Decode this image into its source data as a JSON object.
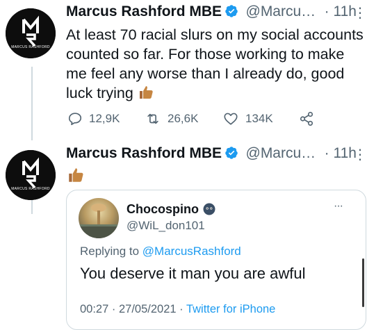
{
  "tweet1": {
    "author_name": "Marcus Rashford MBE",
    "author_handle": "@Marcu…",
    "time": "· 11h",
    "text": "At least 70 racial slurs on my social accounts counted so far. For those working to make me feel any worse than I already do, good luck trying",
    "replies": "12,9K",
    "retweets": "26,6K",
    "likes": "134K",
    "avatar_caption": "MARCUS RASHFORD"
  },
  "tweet2": {
    "author_name": "Marcus Rashford MBE",
    "author_handle": "@Marcu…",
    "time": "· 11h",
    "avatar_caption": "MARCUS RASHFORD"
  },
  "quoted": {
    "name": "Chocospino",
    "handle": "@WiL_don101",
    "replying_prefix": "Replying to",
    "replying_handle": "@MarcusRashford",
    "text": "You deserve it man you are awful",
    "time": "00:27",
    "date": "27/05/2021",
    "source": "Twitter for iPhone"
  },
  "colors": {
    "link": "#1d9bf0",
    "secondary_text": "#536471",
    "verified": "#1d9bf0"
  },
  "icons": [
    "verified-badge-icon",
    "thumbs-up-icon",
    "reply-icon",
    "retweet-icon",
    "like-icon",
    "share-icon",
    "more-options-icon"
  ]
}
